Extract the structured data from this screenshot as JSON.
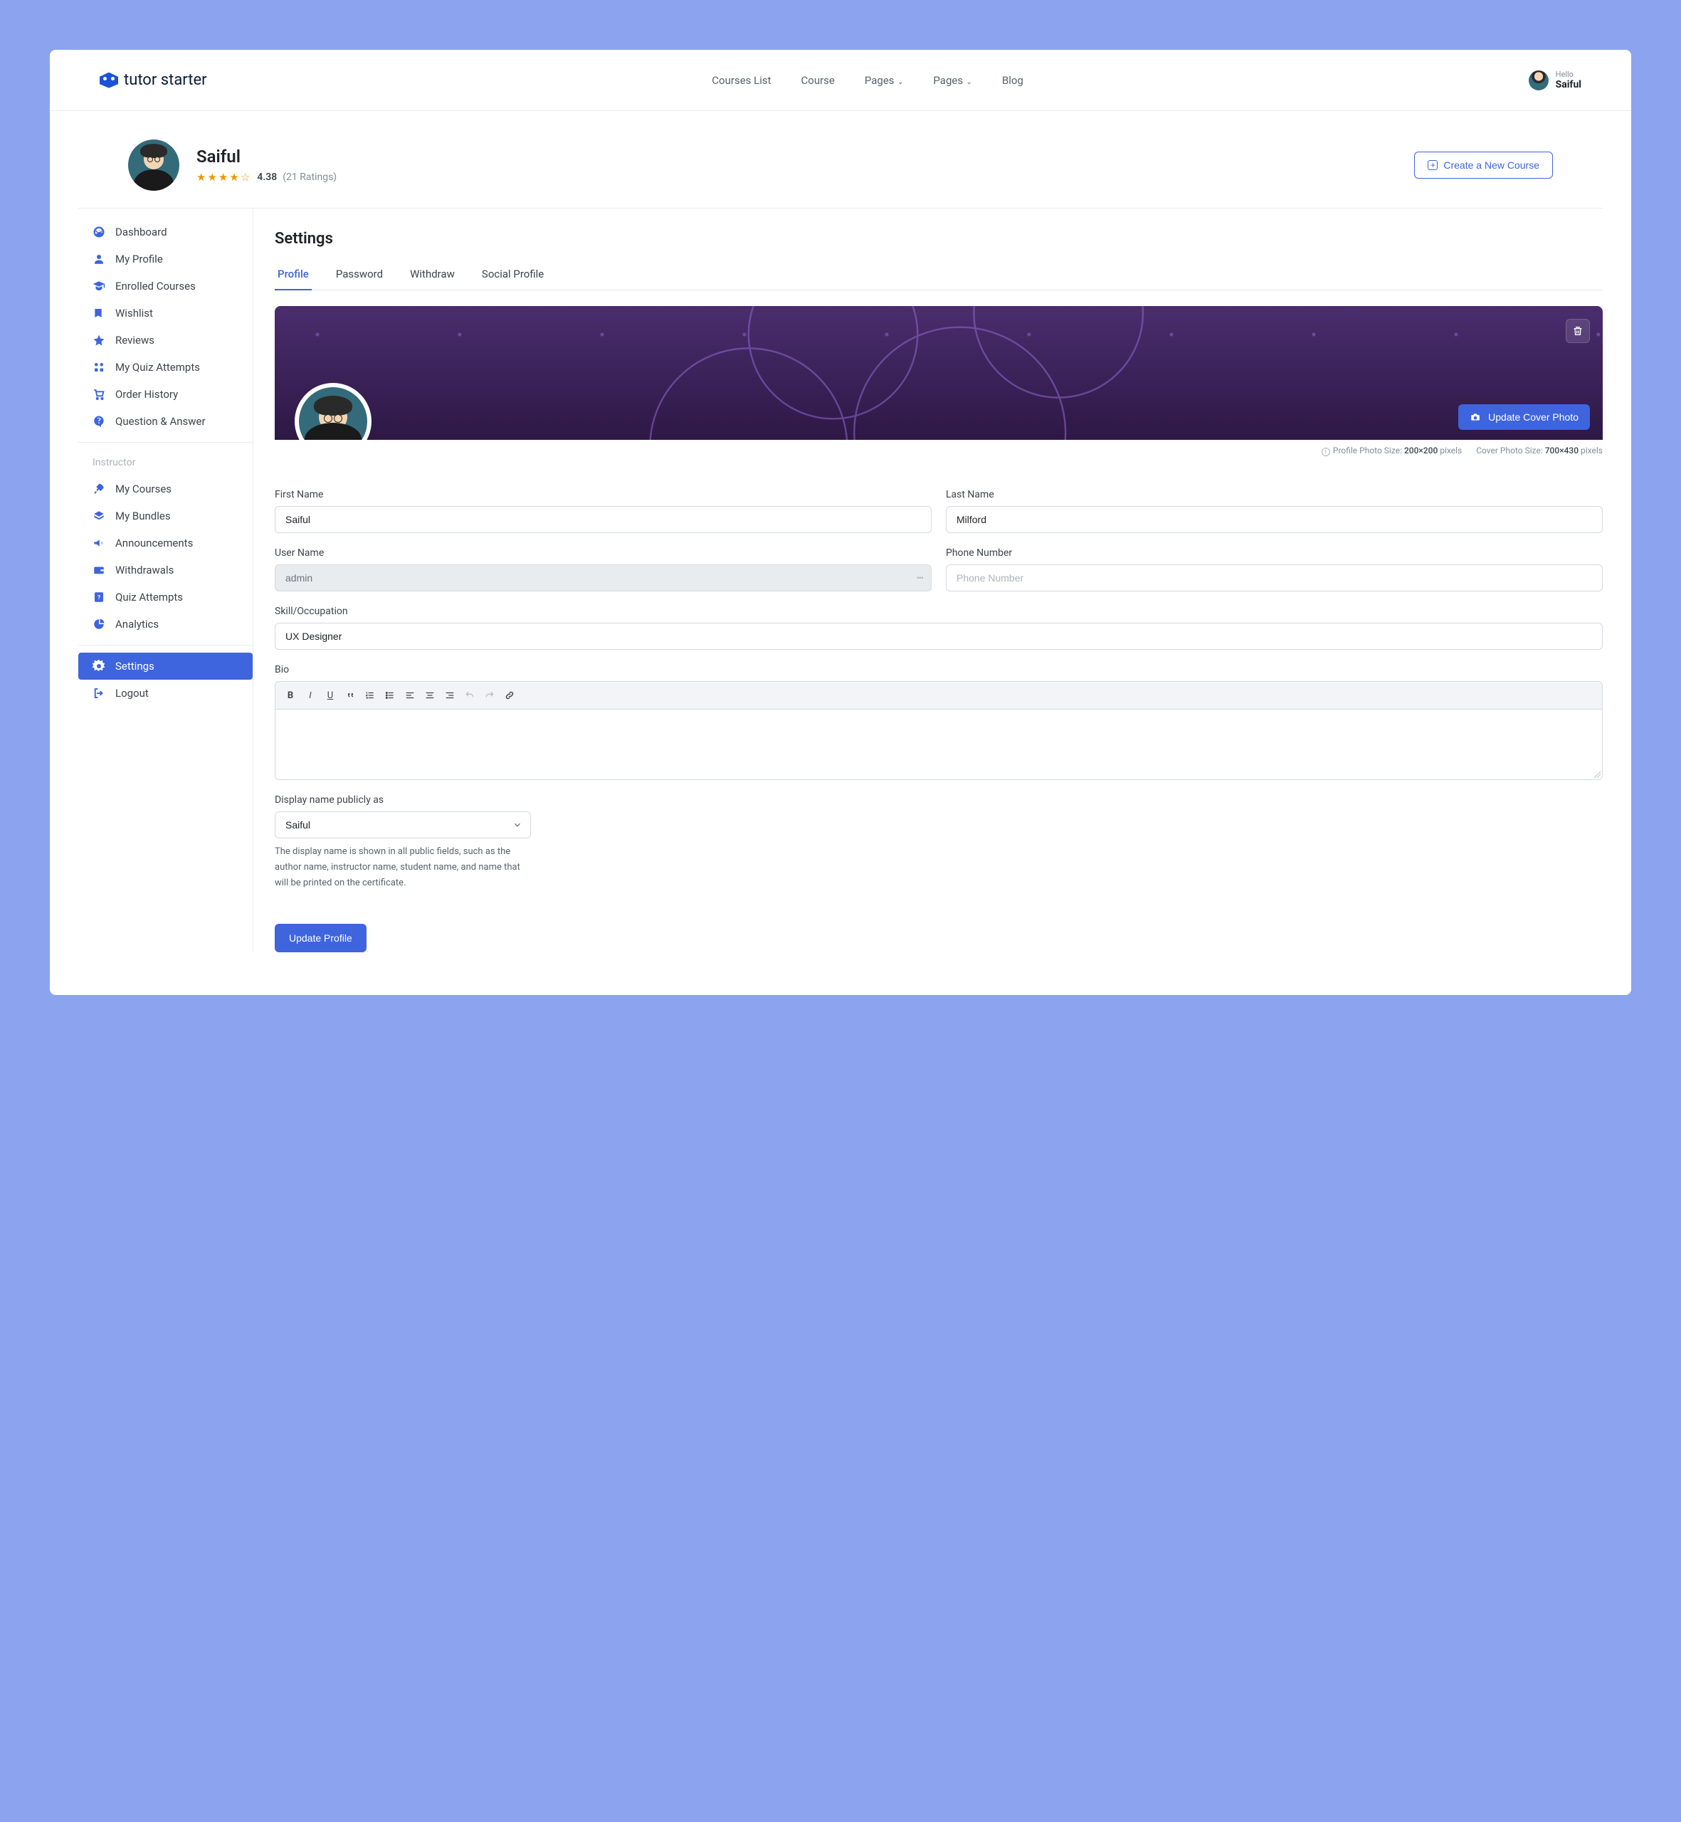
{
  "logo": {
    "text1": "tutor",
    "text2": " starter"
  },
  "topnav": {
    "courses_list": "Courses List",
    "course": "Course",
    "pages1": "Pages",
    "pages2": "Pages",
    "blog": "Blog"
  },
  "user": {
    "hello": "Hello",
    "name": "Saiful"
  },
  "profile": {
    "name": "Saiful",
    "rating": "4.38",
    "rating_count": "(21 Ratings)"
  },
  "create_btn": "Create a New Course",
  "sidebar": {
    "dashboard": "Dashboard",
    "my_profile": "My Profile",
    "enrolled": "Enrolled Courses",
    "wishlist": "Wishlist",
    "reviews": "Reviews",
    "quiz_attempts": "My Quiz Attempts",
    "order_history": "Order History",
    "qa": "Question & Answer",
    "instructor_heading": "Instructor",
    "my_courses": "My Courses",
    "my_bundles": "My Bundles",
    "announcements": "Announcements",
    "withdrawals": "Withdrawals",
    "quiz_attempts2": "Quiz Attempts",
    "analytics": "Analytics",
    "settings": "Settings",
    "logout": "Logout"
  },
  "settings": {
    "title": "Settings",
    "tabs": {
      "profile": "Profile",
      "password": "Password",
      "withdraw": "Withdraw",
      "social": "Social Profile"
    },
    "cover_btn": "Update Cover Photo",
    "hint_profile_label": "Profile Photo Size: ",
    "hint_profile_size": "200×200",
    "hint_cover_label": "Cover Photo Size: ",
    "hint_cover_size": "700×430",
    "pixels": " pixels",
    "labels": {
      "first_name": "First Name",
      "last_name": "Last Name",
      "user_name": "User Name",
      "phone": "Phone Number",
      "skill": "Skill/Occupation",
      "bio": "Bio",
      "display": "Display name publicly as"
    },
    "values": {
      "first_name": "Saiful",
      "last_name": "Milford",
      "user_name": "admin",
      "phone_placeholder": "Phone Number",
      "skill": "UX Designer",
      "display_selected": "Saiful"
    },
    "display_help": "The display name is shown in all public fields, such as the author name, instructor name, student name, and name that will be printed on the certificate.",
    "submit": "Update Profile"
  }
}
